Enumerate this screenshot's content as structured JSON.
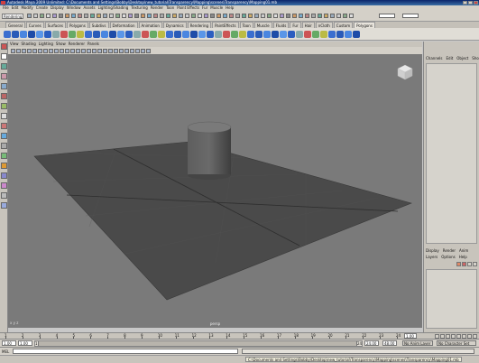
{
  "window": {
    "title": "Autodesk Maya 2009 Unlimited: C:\\Documents and Settings\\Bobby\\Desktop\\new_tutorial\\Transparency\\Mapping\\scenes\\Transparency\\Mapping01.mb"
  },
  "menubar": [
    "File",
    "Edit",
    "Modify",
    "Create",
    "Display",
    "Window",
    "Assets",
    "Lighting/Shading",
    "Texturing",
    "Render",
    "Toon",
    "Paint Effects",
    "Fur",
    "Muscle",
    "Help"
  ],
  "statusline": {
    "mode": "Rendering"
  },
  "shelf_tabs": [
    "General",
    "Curves",
    "Surfaces",
    "Polygons",
    "Subdivs",
    "Deformation",
    "Animation",
    "Dynamics",
    "Rendering",
    "PaintEffects",
    "Toon",
    "Muscle",
    "Fluids",
    "Fur",
    "Hair",
    "nCloth",
    "Custom",
    "Polygons"
  ],
  "shelf_active_tab": "Polygons",
  "panel_menu": [
    "View",
    "Shading",
    "Lighting",
    "Show",
    "Renderer",
    "Panels"
  ],
  "viewport": {
    "camera_label": "persp",
    "axis_label": "x y z"
  },
  "right_panel": {
    "top_menu": [
      "Channels",
      "Edit",
      "Object",
      "Show"
    ],
    "layer_tabs": [
      "Display",
      "Render",
      "Anim"
    ],
    "layer_menu": [
      "Layers",
      "Options",
      "Help"
    ]
  },
  "timeline": {
    "ticks": [
      "1",
      "2",
      "3",
      "4",
      "5",
      "6",
      "7",
      "8",
      "9",
      "10",
      "11",
      "12",
      "13",
      "14",
      "15",
      "16",
      "17",
      "18",
      "19",
      "20",
      "21",
      "22",
      "23",
      "24"
    ],
    "current_frame": "1.00"
  },
  "range": {
    "start": "1.00",
    "start2": "1.00",
    "range_start_box": "1",
    "range_end_box": "24",
    "end": "24.00",
    "end2": "48.00",
    "layer": "No Anim Layer",
    "character": "No Character Set"
  },
  "cmdline": {
    "label": "MEL"
  },
  "helpline": {
    "path": "C:\\Documents and Settings\\Bobby\\Desktop\\new_tutorial\\Transparency\\Mapping\\scenes\\Transparency\\Mapping01.mb"
  },
  "colors": {
    "viewport_bg": "#7a7a7a",
    "plane": "#4c4c4c",
    "cylinder": "#5a5a5a",
    "ui_bg": "#d4d0c8",
    "title_blue": "#0a246a"
  }
}
